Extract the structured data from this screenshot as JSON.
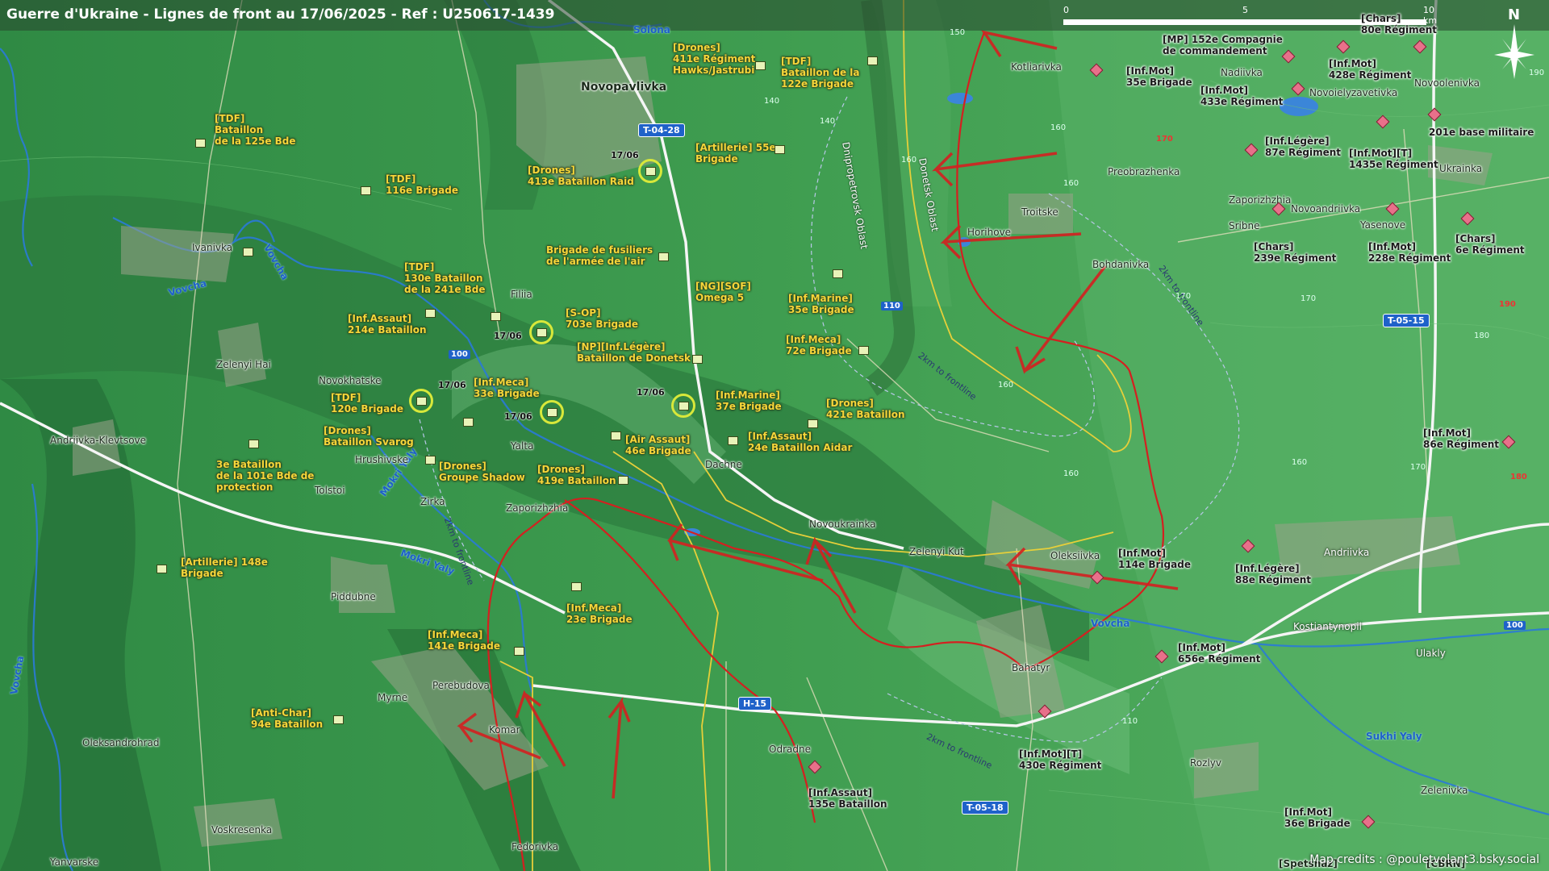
{
  "title": "Guerre d'Ukraine - Lignes de front au 17/06/2025 - Ref : U250617-1439",
  "credits": "Map credits : @pouletvolant3.bsky.social",
  "scale": {
    "zero": "0",
    "mid": "5",
    "end": "10 km"
  },
  "north": "N",
  "colors": {
    "ukraine_units": "#f6d63a",
    "russia_units": "#e8708a",
    "front_arrows": "#d42020",
    "roads": "#1f62c9",
    "terrain": "#3d9b4e"
  },
  "places": {
    "novopavlivka": "Novopavlivka",
    "ivanivka": "Ivanivka",
    "filiia": "Filiia",
    "zelenyi_hai": "Zelenyi Hai",
    "novokhatske": "Novokhatske",
    "andriivka_klevtsove": "Andriivka-Klevtsove",
    "hrushivske": "Hrushivske",
    "tolstoi": "Tolstoi",
    "zirka": "Zirka",
    "yalta": "Yalta",
    "zaporizhzhia_w": "Zaporizhzhia",
    "dachne": "Dachne",
    "novoukrainka": "Novoukrainka",
    "zelenyi_kut": "Zelenyi Kut",
    "oleksiivka": "Oleksiivka",
    "bahatyr": "Bahatyr",
    "piddubne": "Piddubne",
    "perebudova": "Perebudova",
    "myrne": "Myrne",
    "komar": "Komar",
    "oleksandrohrad": "Oleksandrohrad",
    "voskresenka": "Voskresenka",
    "yanvarske": "Yanvarske",
    "fedorivka": "Fedorivka",
    "odradne": "Odradne",
    "kotliarivka": "Kotliarivka",
    "nadiivka": "Nadiivka",
    "novoielyzavetivka": "Novoielyzavetivka",
    "novoolenivka": "Novoolenivka",
    "preobrazhenka": "Preobrazhenka",
    "zaporizhzhia_e": "Zaporizhzhia",
    "troitske": "Troitske",
    "horihove": "Horihove",
    "bohdanivka": "Bohdanivka",
    "sribne": "Sribne",
    "novoandriivka": "Novoandriivka",
    "yasenove": "Yasenove",
    "ukrainka": "Ukrainka",
    "andriivka": "Andriivka",
    "kostiantynopil": "Kostiantynopil",
    "ulakly": "Ulakly",
    "rozlyv": "Rozlyv",
    "zelenivka": "Zelenivka",
    "spetsnaz": "[Spetsnaz]",
    "cbrn": "[CBRN]"
  },
  "rivers": {
    "solona": "Solona",
    "vovcha_nw": "Vovcha",
    "vovcha_w": "Vovcha",
    "vovcha_e": "Vovcha",
    "vovcha_sw": "Vovcha",
    "mokri_yaly1": "Mokri Yaly",
    "mokri_yaly2": "Mokri Yaly",
    "sukhi_yaly": "Sukhi Yaly"
  },
  "oblasts": {
    "dnipro": "Dnipropetrovsk Oblast",
    "donetsk": "Donetsk Oblast"
  },
  "front_labels": {
    "a": "2km to frontline",
    "b": "2km to frontline",
    "c": "2km to frontline",
    "d": "2km to frontline"
  },
  "roads": {
    "t0428": "T-04-28",
    "t0515": "T-05-15",
    "t0518": "T-05-18",
    "h15": "H-15"
  },
  "elevations": [
    "150",
    "140",
    "140",
    "160",
    "160",
    "170",
    "170",
    "160",
    "160",
    "180",
    "190",
    "170",
    "100",
    "110",
    "160",
    "160",
    "170",
    "180",
    "110",
    "110",
    "100",
    "100",
    "190"
  ],
  "ua_units": [
    {
      "id": "u1",
      "label": "[Drones]\n411e Régiment\nHawks/Jastrubi"
    },
    {
      "id": "u2",
      "label": "[TDF]\nBataillon de la\n122e Brigade"
    },
    {
      "id": "u3",
      "label": "[TDF]\nBataillon\nde la 125e Bde"
    },
    {
      "id": "u4",
      "label": "[Artillerie] 55e\nBrigade"
    },
    {
      "id": "u5",
      "label": "[Drones]\n413e Bataillon Raid"
    },
    {
      "id": "u6",
      "label": "[TDF]\n116e Brigade"
    },
    {
      "id": "u7",
      "label": "Brigade de fusiliers\nde l'armée de l'air"
    },
    {
      "id": "u8",
      "label": "[TDF]\n130e Bataillon\nde la 241e Bde"
    },
    {
      "id": "u9",
      "label": "[NG][SOF]\nOmega 5"
    },
    {
      "id": "u10",
      "label": "[Inf.Marine]\n35e Brigade"
    },
    {
      "id": "u11",
      "label": "[S-OP]\n703e Brigade"
    },
    {
      "id": "u12",
      "label": "[Inf.Assaut]\n214e Bataillon"
    },
    {
      "id": "u13",
      "label": "[Inf.Meca]\n72e Brigade"
    },
    {
      "id": "u14",
      "label": "[NP][Inf.Légère]\nBataillon de Donetsk"
    },
    {
      "id": "u15",
      "label": "[Inf.Meca]\n33e Brigade"
    },
    {
      "id": "u16",
      "label": "[TDF]\n120e Brigade"
    },
    {
      "id": "u17",
      "label": "[Inf.Marine]\n37e Brigade"
    },
    {
      "id": "u18",
      "label": "[Drones]\n421e Bataillon"
    },
    {
      "id": "u19",
      "label": "[Drones]\nBataillon Svarog"
    },
    {
      "id": "u20",
      "label": "[Air Assaut]\n46e Brigade"
    },
    {
      "id": "u21",
      "label": "[Inf.Assaut]\n24e Bataillon Aidar"
    },
    {
      "id": "u22",
      "label": "3e Bataillon\nde la 101e Bde de\nprotection"
    },
    {
      "id": "u23",
      "label": "[Drones]\nGroupe Shadow"
    },
    {
      "id": "u24",
      "label": "[Drones]\n419e Bataillon"
    },
    {
      "id": "u25",
      "label": "[Artillerie] 148e\nBrigade"
    },
    {
      "id": "u26",
      "label": "[Inf.Meca]\n23e Brigade"
    },
    {
      "id": "u27",
      "label": "[Inf.Meca]\n141e Brigade"
    },
    {
      "id": "u28",
      "label": "[Anti-Char]\n94e Bataillon"
    }
  ],
  "ru_units": [
    {
      "id": "r1",
      "label": "[Chars]\n80e Régiment"
    },
    {
      "id": "r2",
      "label": "[MP] 152e Compagnie\nde commandement"
    },
    {
      "id": "r3",
      "label": "[Inf.Mot]\n35e Brigade"
    },
    {
      "id": "r4",
      "label": "[Inf.Mot]\n428e Régiment"
    },
    {
      "id": "r5",
      "label": "[Inf.Mot]\n433e Régiment"
    },
    {
      "id": "r6",
      "label": "201e base militaire"
    },
    {
      "id": "r7",
      "label": "[Inf.Légère]\n87e Régiment"
    },
    {
      "id": "r8",
      "label": "[Inf.Mot][T]\n1435e Régiment"
    },
    {
      "id": "r9",
      "label": "[Chars]\n239e Régiment"
    },
    {
      "id": "r10",
      "label": "[Inf.Mot]\n228e Régiment"
    },
    {
      "id": "r11",
      "label": "[Chars]\n6e Régiment"
    },
    {
      "id": "r12",
      "label": "[Inf.Mot]\n86e Régiment"
    },
    {
      "id": "r13",
      "label": "[Inf.Mot]\n114e Brigade"
    },
    {
      "id": "r14",
      "label": "[Inf.Légère]\n88e Régiment"
    },
    {
      "id": "r15",
      "label": "[Inf.Mot]\n656e Régiment"
    },
    {
      "id": "r16",
      "label": "[Inf.Mot][T]\n430e Régiment"
    },
    {
      "id": "r17",
      "label": "[Inf.Assaut]\n135e Bataillon"
    },
    {
      "id": "r18",
      "label": "[Inf.Mot]\n36e Brigade"
    }
  ],
  "dates": [
    "17/06",
    "17/06",
    "17/06",
    "17/06",
    "17/06"
  ]
}
